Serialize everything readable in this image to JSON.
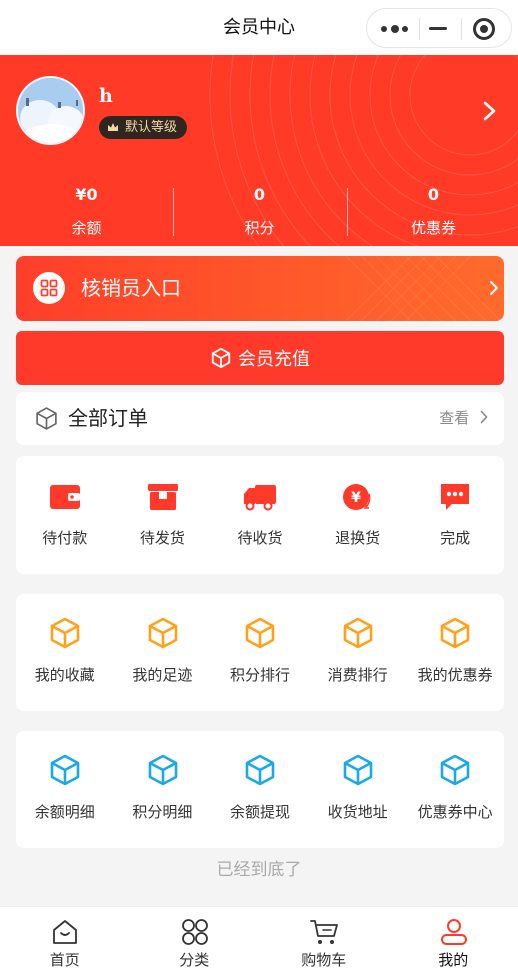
{
  "app": {
    "title": "会员中心"
  },
  "profile": {
    "username": "h",
    "level": "默认等级",
    "stats": [
      {
        "value": "¥0",
        "label": "余额"
      },
      {
        "value": "0",
        "label": "积分"
      },
      {
        "value": "0",
        "label": "优惠券"
      }
    ]
  },
  "verifier": {
    "label": "核销员入口"
  },
  "recharge": {
    "label": "会员充值"
  },
  "orders": {
    "title": "全部订单",
    "view_label": "查看",
    "items": [
      {
        "label": "待付款",
        "icon": "wallet-icon"
      },
      {
        "label": "待发货",
        "icon": "package-icon"
      },
      {
        "label": "待收货",
        "icon": "truck-icon"
      },
      {
        "label": "退换货",
        "icon": "refund-icon"
      },
      {
        "label": "完成",
        "icon": "chat-icon"
      }
    ]
  },
  "services_1": [
    {
      "label": "我的收藏",
      "icon": "cube-icon"
    },
    {
      "label": "我的足迹",
      "icon": "cube-icon"
    },
    {
      "label": "积分排行",
      "icon": "cube-icon"
    },
    {
      "label": "消费排行",
      "icon": "cube-icon"
    },
    {
      "label": "我的优惠券",
      "icon": "cube-icon"
    }
  ],
  "services_2": [
    {
      "label": "余额明细",
      "icon": "cube-icon"
    },
    {
      "label": "积分明细",
      "icon": "cube-icon"
    },
    {
      "label": "余额提现",
      "icon": "cube-icon"
    },
    {
      "label": "收货地址",
      "icon": "cube-icon"
    },
    {
      "label": "优惠券中心",
      "icon": "cube-icon"
    }
  ],
  "footer_text": "已经到底了",
  "tabbar": [
    {
      "label": "首页",
      "icon": "home-icon"
    },
    {
      "label": "分类",
      "icon": "category-icon"
    },
    {
      "label": "购物车",
      "icon": "cart-icon"
    },
    {
      "label": "我的",
      "icon": "user-icon",
      "active": true
    }
  ],
  "colors": {
    "brand": "#ff3a26",
    "orange": "#ffa21a",
    "blue": "#1aa9e8",
    "level_bg": "#2f2620",
    "level_text": "#f5d7a4"
  }
}
